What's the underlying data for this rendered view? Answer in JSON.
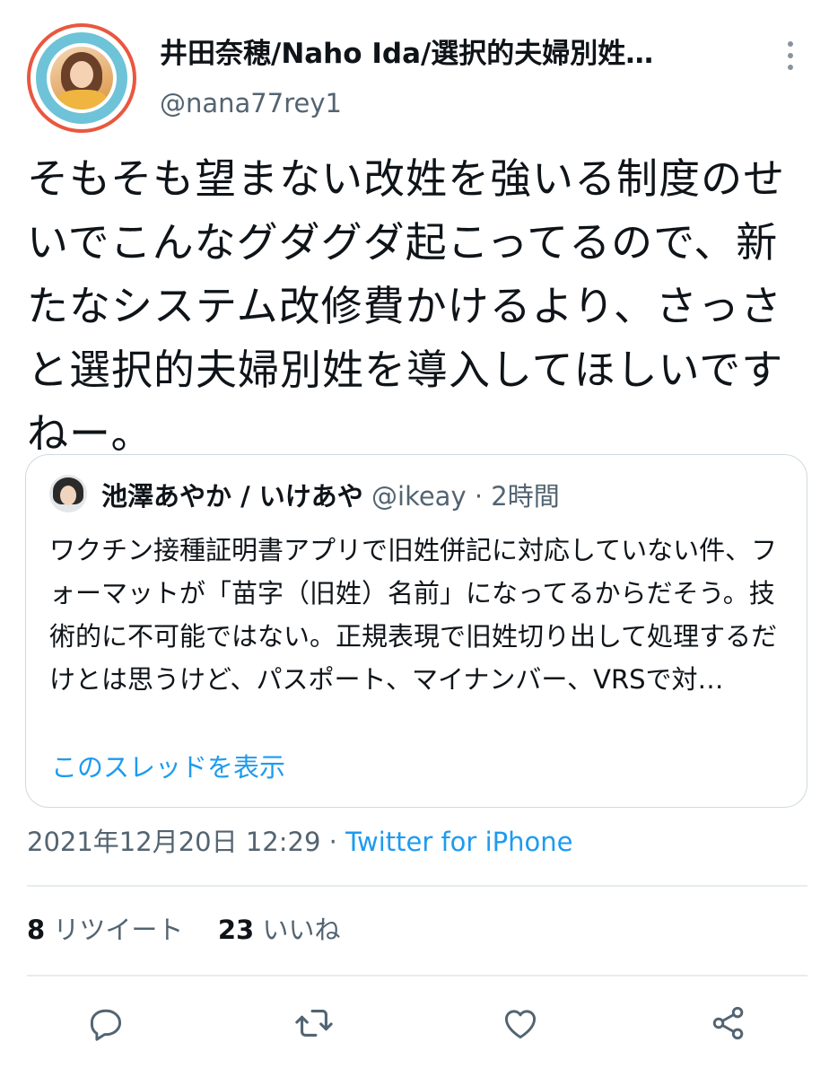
{
  "author": {
    "display_name": "井田奈穂/Naho Ida/選択的夫婦別姓…",
    "handle": "@nana77rey1"
  },
  "tweet": {
    "text": "そもそも望まない改姓を強いる制度のせいでこんなグダグダ起こってるので、新たなシステム改修費かけるより、さっさと選択的夫婦別姓を導入してほしいですねー。"
  },
  "quoted": {
    "name": "池澤あやか / いけあや",
    "handle": "@ikeay",
    "separator": "·",
    "time": "2時間",
    "text": "ワクチン接種証明書アプリで旧姓併記に対応していない件、フォーマットが「苗字（旧姓）名前」になってるからだそう。技術的に不可能ではない。正規表現で旧姓切り出して処理するだけとは思うけど、パスポート、マイナンバー、VRSで対…",
    "thread_link": "このスレッドを表示"
  },
  "meta": {
    "datetime": "2021年12月20日 12:29",
    "separator": "·",
    "source": "Twitter for iPhone"
  },
  "stats": {
    "retweets_count": "8",
    "retweets_label": "リツイート",
    "likes_count": "23",
    "likes_label": "いいね"
  },
  "actions": [
    {
      "icon": "reply-icon"
    },
    {
      "icon": "retweet-icon"
    },
    {
      "icon": "like-icon"
    },
    {
      "icon": "share-icon"
    }
  ],
  "colors": {
    "accent": "#1d9bf0",
    "text": "#0f1419",
    "secondary": "#536471",
    "border": "#cfd9de"
  }
}
